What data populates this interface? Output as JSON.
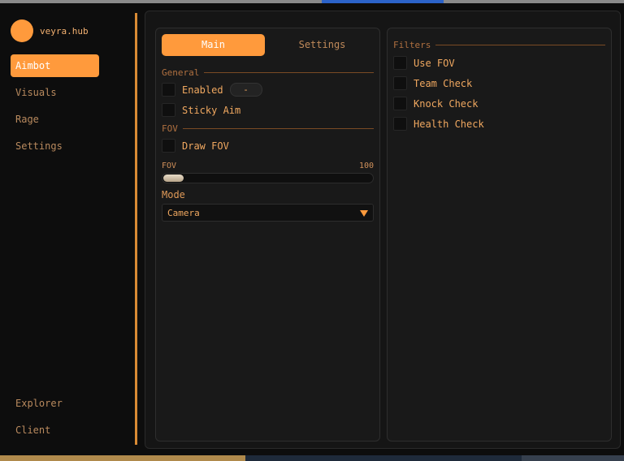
{
  "brand": {
    "name": "veyra.hub"
  },
  "sidebar": {
    "items": [
      {
        "label": "Aimbot",
        "active": true
      },
      {
        "label": "Visuals"
      },
      {
        "label": "Rage"
      },
      {
        "label": "Settings"
      }
    ],
    "bottom_items": [
      {
        "label": "Explorer"
      },
      {
        "label": "Client"
      }
    ]
  },
  "tabs": {
    "main": "Main",
    "settings": "Settings"
  },
  "general": {
    "title": "General",
    "enabled_label": "Enabled",
    "keybind": "-",
    "sticky_label": "Sticky Aim"
  },
  "fov": {
    "title": "FOV",
    "draw_label": "Draw FOV",
    "slider_label": "FOV",
    "slider_value": "100"
  },
  "mode": {
    "label": "Mode",
    "value": "Camera"
  },
  "filters": {
    "title": "Filters",
    "items": [
      {
        "label": "Use FOV"
      },
      {
        "label": "Team Check"
      },
      {
        "label": "Knock Check"
      },
      {
        "label": "Health Check"
      }
    ]
  },
  "colors": {
    "accent": "#ff9a3c",
    "background": "#0d0d0d",
    "panel": "#191919"
  }
}
